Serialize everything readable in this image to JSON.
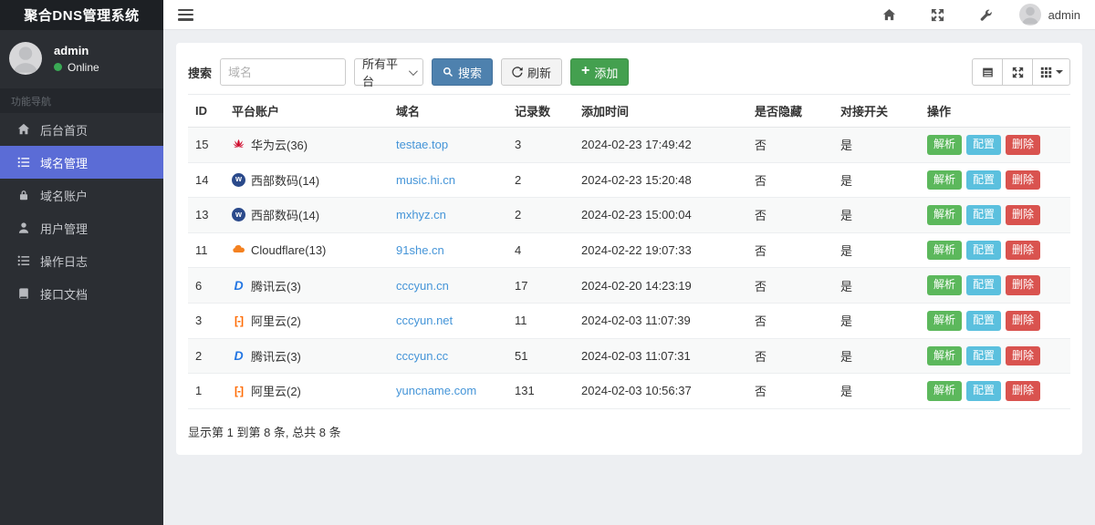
{
  "app": {
    "brand": "聚合DNS管理系统"
  },
  "topbar": {
    "username": "admin",
    "icons": [
      "home-icon",
      "fullscreen-icon",
      "wrench-icon"
    ]
  },
  "sidebar": {
    "user": {
      "name": "admin",
      "status": "Online"
    },
    "nav_label": "功能导航",
    "items": [
      {
        "label": "后台首页",
        "icon": "home-icon",
        "active": false
      },
      {
        "label": "域名管理",
        "icon": "list-icon",
        "active": true
      },
      {
        "label": "域名账户",
        "icon": "lock-icon",
        "active": false
      },
      {
        "label": "用户管理",
        "icon": "user-icon",
        "active": false
      },
      {
        "label": "操作日志",
        "icon": "log-icon",
        "active": false
      },
      {
        "label": "接口文档",
        "icon": "book-icon",
        "active": false
      }
    ]
  },
  "toolbar": {
    "search_label": "搜索",
    "search_placeholder": "域名",
    "platform_filter": "所有平台",
    "search_button": "搜索",
    "refresh_button": "刷新",
    "add_button": "添加",
    "view_buttons": [
      "toggle-view-icon",
      "fullscreen-toggle-icon",
      "columns-grid-icon"
    ]
  },
  "table": {
    "columns": [
      "ID",
      "平台账户",
      "域名",
      "记录数",
      "添加时间",
      "是否隐藏",
      "对接开关",
      "操作"
    ],
    "actions": {
      "parse": "解析",
      "config": "配置",
      "delete": "删除"
    },
    "rows": [
      {
        "id": "15",
        "icon": "huawei-cloud-icon",
        "platform": "华为云(36)",
        "domain": "testae.top",
        "records": "3",
        "added": "2024-02-23 17:49:42",
        "hidden": "否",
        "linked": "是"
      },
      {
        "id": "14",
        "icon": "west-digital-icon",
        "platform": "西部数码(14)",
        "domain": "music.hi.cn",
        "records": "2",
        "added": "2024-02-23 15:20:48",
        "hidden": "否",
        "linked": "是"
      },
      {
        "id": "13",
        "icon": "west-digital-icon",
        "platform": "西部数码(14)",
        "domain": "mxhyz.cn",
        "records": "2",
        "added": "2024-02-23 15:00:04",
        "hidden": "否",
        "linked": "是"
      },
      {
        "id": "11",
        "icon": "cloudflare-icon",
        "platform": "Cloudflare(13)",
        "domain": "91she.cn",
        "records": "4",
        "added": "2024-02-22 19:07:33",
        "hidden": "否",
        "linked": "是"
      },
      {
        "id": "6",
        "icon": "tencent-cloud-icon",
        "platform": "腾讯云(3)",
        "domain": "cccyun.cn",
        "records": "17",
        "added": "2024-02-20 14:23:19",
        "hidden": "否",
        "linked": "是"
      },
      {
        "id": "3",
        "icon": "aliyun-icon",
        "platform": "阿里云(2)",
        "domain": "cccyun.net",
        "records": "11",
        "added": "2024-02-03 11:07:39",
        "hidden": "否",
        "linked": "是"
      },
      {
        "id": "2",
        "icon": "tencent-cloud-icon",
        "platform": "腾讯云(3)",
        "domain": "cccyun.cc",
        "records": "51",
        "added": "2024-02-03 11:07:31",
        "hidden": "否",
        "linked": "是"
      },
      {
        "id": "1",
        "icon": "aliyun-icon",
        "platform": "阿里云(2)",
        "domain": "yuncname.com",
        "records": "131",
        "added": "2024-02-03 10:56:37",
        "hidden": "否",
        "linked": "是"
      }
    ]
  },
  "footer": {
    "summary": "显示第 1 到第 8 条, 总共 8 条"
  },
  "colors": {
    "accent": "#5b6cd6",
    "sidebar_bg": "#2b2e33",
    "brand_bg": "#1d2024",
    "primary_btn": "#4e81ae",
    "add_btn": "#44a04f",
    "success": "#5cb85c",
    "info": "#5bc0de",
    "danger": "#d9534f",
    "link": "#4595d8",
    "hidden_no": "#4545e0",
    "linked_yes": "#55a455",
    "online_dot": "#3aa955",
    "huawei_red": "#cf0a2c",
    "cloudflare_orange": "#f48120"
  }
}
